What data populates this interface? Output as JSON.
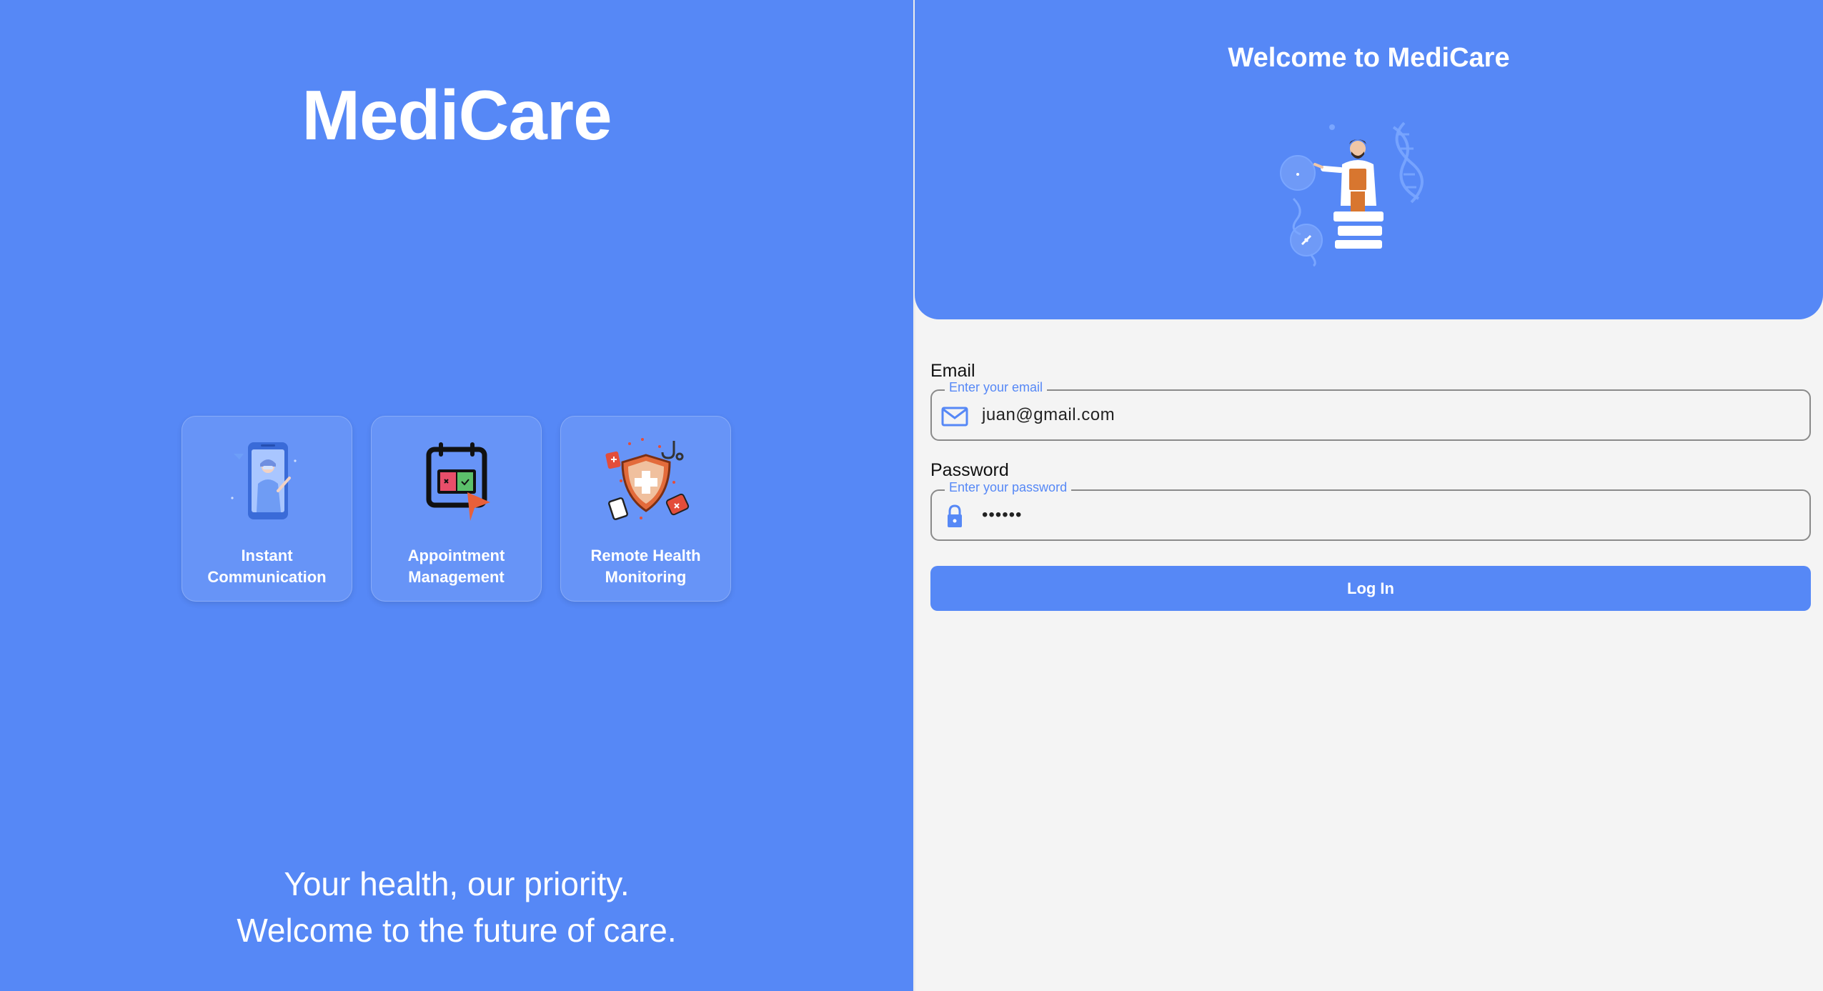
{
  "brand": "MediCare",
  "features": [
    {
      "line1": "Instant",
      "line2": "Communication"
    },
    {
      "line1": "Appointment",
      "line2": "Management"
    },
    {
      "line1": "Remote Health",
      "line2": "Monitoring"
    }
  ],
  "tagline": {
    "line1": "Your health, our priority.",
    "line2": "Welcome to the future of care."
  },
  "login": {
    "welcome": "Welcome to MediCare",
    "email_label": "Email",
    "email_placeholder": "Enter your email",
    "email_value": "juan@gmail.com",
    "password_label": "Password",
    "password_placeholder": "Enter your password",
    "password_value": "••••••",
    "submit_label": "Log In"
  },
  "colors": {
    "primary": "#5688f6",
    "background": "#f4f4f4",
    "accent_orange": "#d8762f"
  },
  "icons": [
    "phone-doctor-icon",
    "calendar-icon",
    "health-shield-icon",
    "doctor-illustration",
    "mail-icon",
    "lock-icon"
  ]
}
